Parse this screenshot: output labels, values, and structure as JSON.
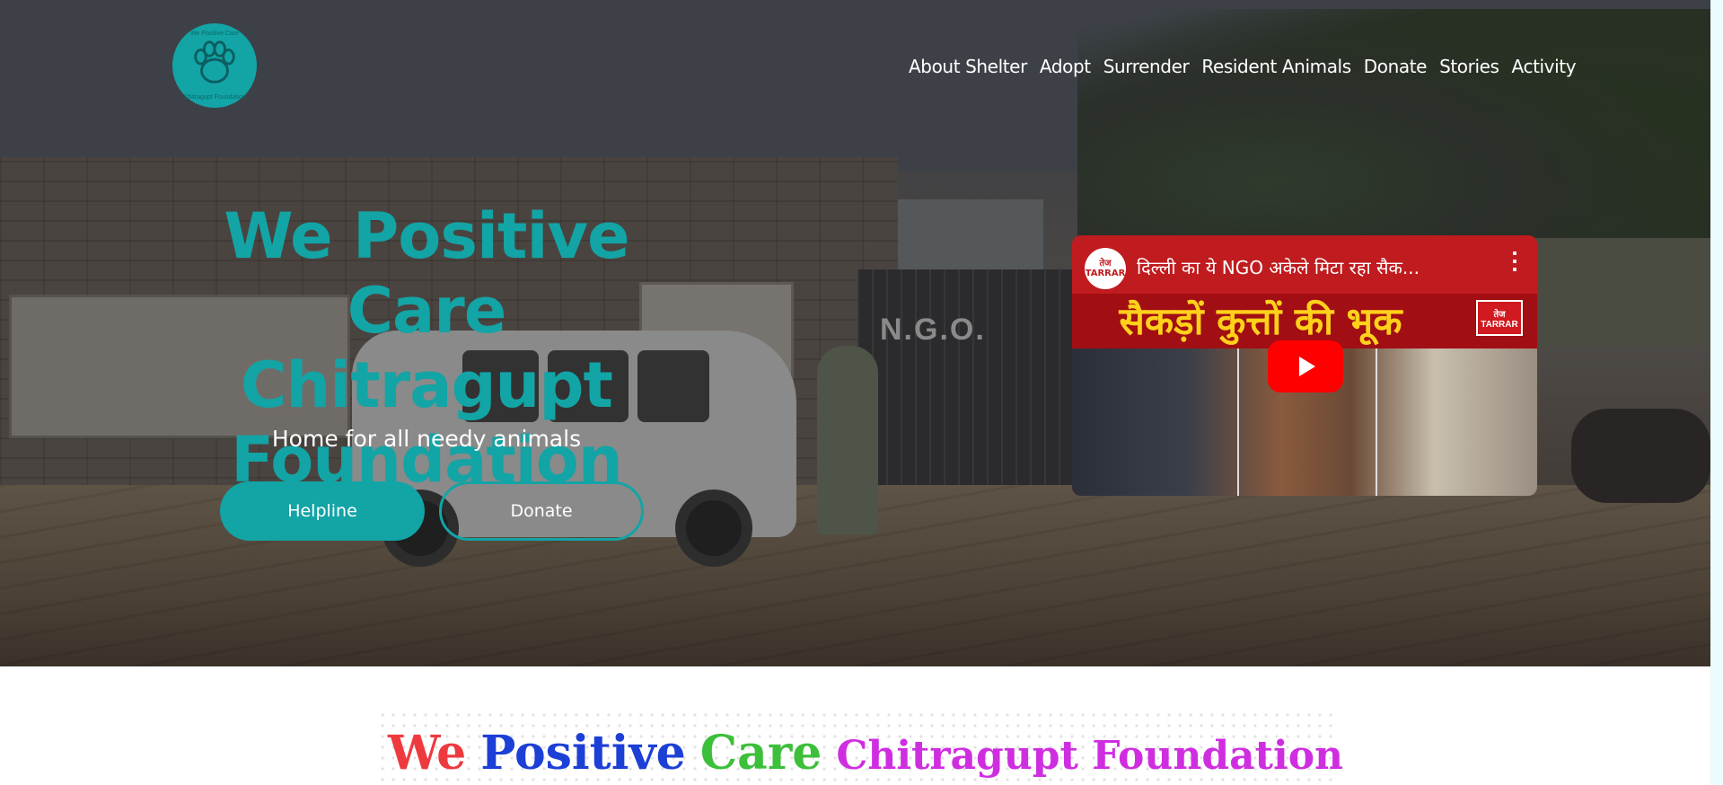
{
  "brand": {
    "logo_icon": "paw-logo-icon",
    "logo_top_text": "We Positive Care",
    "logo_center_text": "We Positive Care",
    "logo_bottom_text": "Chitragupt Foundation",
    "accent_color": "#13a4a6"
  },
  "nav": {
    "items": [
      {
        "label": "About Shelter"
      },
      {
        "label": "Adopt"
      },
      {
        "label": "Surrender"
      },
      {
        "label": "Resident Animals"
      },
      {
        "label": "Donate"
      },
      {
        "label": "Stories"
      },
      {
        "label": "Activity"
      }
    ]
  },
  "hero": {
    "title_line1": "We Positive Care",
    "title_line2": "Chitragupt",
    "title_line3": "Foundation",
    "subtitle": "Home for all needy animals",
    "helpline_label": "Helpline",
    "donate_label": "Donate",
    "scene_gate_text": "N.G.O."
  },
  "video": {
    "title": "दिल्ली का ये NGO अकेले मिटा रहा सैक...",
    "headline": "सैकड़ों कुत्तों की भूक",
    "channel_badge": "तेज TARRAR",
    "channel_logo_small": "तेज TARRAR",
    "more_icon": "more-vert-icon",
    "play_icon": "play-icon"
  },
  "section2": {
    "title_words": [
      {
        "text": "We",
        "color": "#ee3a3f"
      },
      {
        "text": "Positive",
        "color": "#1c3fd6"
      },
      {
        "text": "Care",
        "color": "#3cbf3a"
      }
    ],
    "title_suffix": "Chitragupt Foundation",
    "title_suffix_color": "#cf2ee0"
  }
}
